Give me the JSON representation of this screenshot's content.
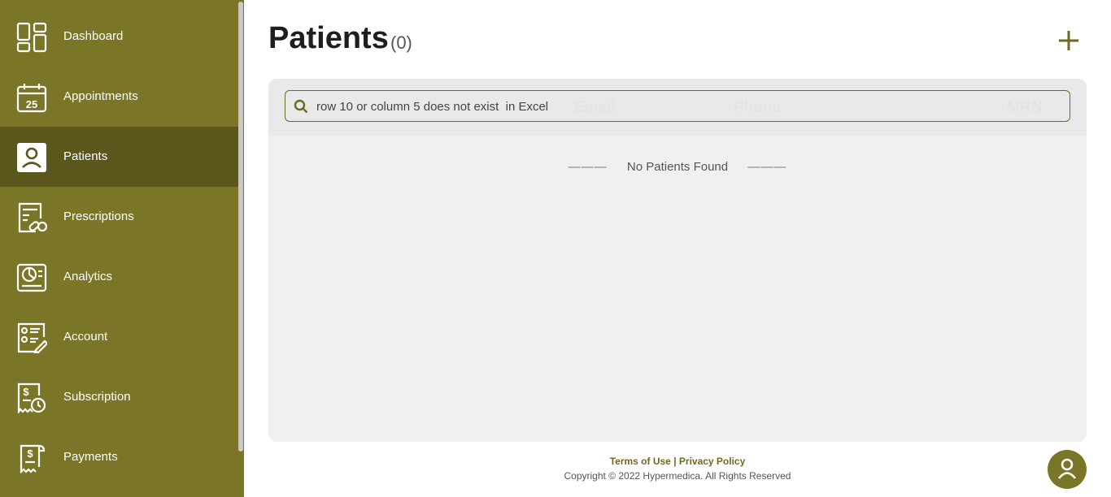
{
  "sidebar": {
    "items": [
      {
        "label": "Dashboard",
        "icon": "dashboard-icon"
      },
      {
        "label": "Appointments",
        "icon": "calendar-icon",
        "calendar_day": "25"
      },
      {
        "label": "Patients",
        "icon": "patient-icon",
        "active": true
      },
      {
        "label": "Prescriptions",
        "icon": "prescription-icon"
      },
      {
        "label": "Analytics",
        "icon": "analytics-icon"
      },
      {
        "label": "Account",
        "icon": "account-icon"
      },
      {
        "label": "Subscription",
        "icon": "subscription-icon"
      },
      {
        "label": "Payments",
        "icon": "payments-icon"
      }
    ]
  },
  "main": {
    "title": "Patients",
    "count": "(0)",
    "search": {
      "value": "row 10 or column 5 does not exist  in Excel",
      "placeholder": ""
    },
    "columns": [
      "Email",
      "Phone",
      "MRN"
    ],
    "empty_message": "No Patients Found",
    "empty_dash": "———"
  },
  "footer": {
    "terms": "Terms of Use",
    "separator": "|",
    "privacy": "Privacy Policy",
    "copyright": "Copyright © 2022 Hypermedica. All Rights Reserved"
  },
  "colors": {
    "sidebar_bg": "#7b7627",
    "sidebar_active": "#5a561c",
    "accent": "#6d6a22",
    "panel_bg": "#f0f0f0"
  }
}
